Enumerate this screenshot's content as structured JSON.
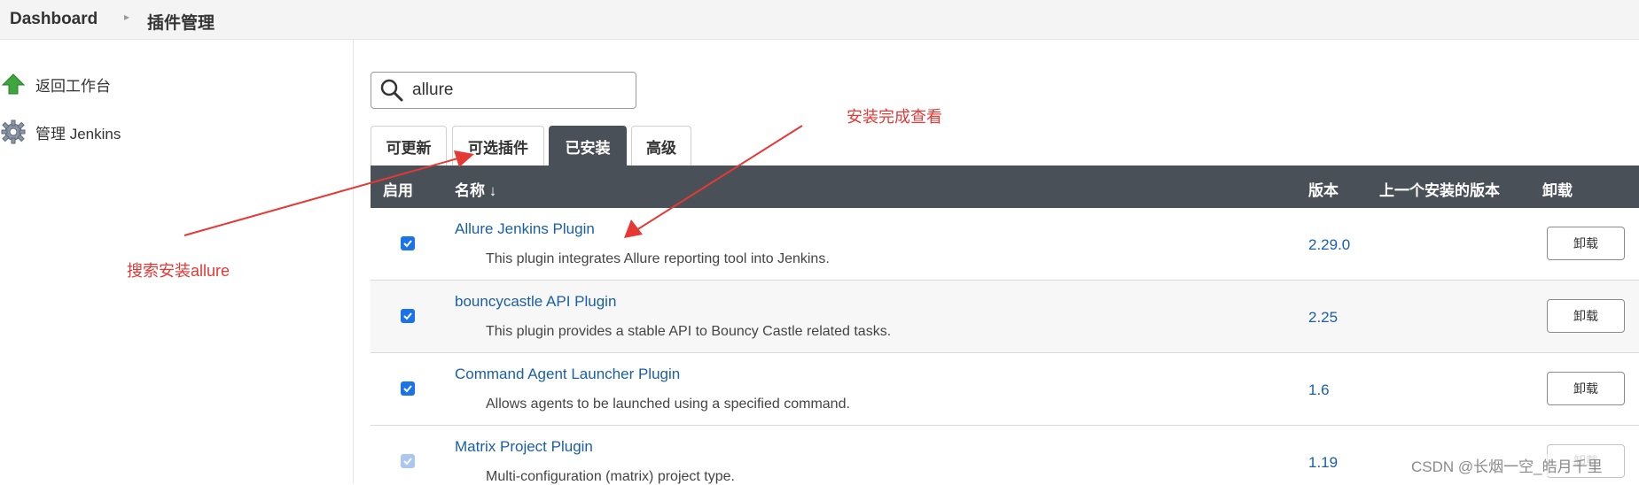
{
  "breadcrumb": {
    "home": "Dashboard",
    "current": "插件管理"
  },
  "sidebar": {
    "items": [
      {
        "label": "返回工作台",
        "icon": "up-arrow-icon"
      },
      {
        "label": "管理 Jenkins",
        "icon": "gear-icon"
      }
    ]
  },
  "search": {
    "value": "allure",
    "icon": "search-icon"
  },
  "tabs": [
    {
      "label": "可更新",
      "active": false
    },
    {
      "label": "可选插件",
      "active": false
    },
    {
      "label": "已安装",
      "active": true
    },
    {
      "label": "高级",
      "active": false
    }
  ],
  "table": {
    "headers": {
      "enabled": "启用",
      "name": "名称 ↓",
      "version": "版本",
      "previous": "上一个安装的版本",
      "uninstall": "卸载"
    },
    "rows": [
      {
        "enabled": true,
        "name": "Allure Jenkins Plugin",
        "description": "This plugin integrates Allure reporting tool into Jenkins.",
        "version": "2.29.0",
        "uninstall": "卸载"
      },
      {
        "enabled": true,
        "name": "bouncycastle API Plugin",
        "description": "This plugin provides a stable API to Bouncy Castle related tasks.",
        "version": "2.25",
        "uninstall": "卸载"
      },
      {
        "enabled": true,
        "name": "Command Agent Launcher Plugin",
        "description": "Allows agents to be launched using a specified command.",
        "version": "1.6",
        "uninstall": "卸载"
      },
      {
        "enabled": true,
        "name": "Matrix Project Plugin",
        "description": "Multi-configuration (matrix) project type.",
        "version": "1.19",
        "uninstall": "卸载"
      }
    ]
  },
  "annotations": {
    "search_note": "搜索安装allure",
    "installed_note": "安装完成查看"
  },
  "watermark": "CSDN @长烟一空_皓月千里",
  "colors": {
    "header_bg": "#4a5058",
    "link": "#1a5fa5",
    "annotation": "#e53935",
    "checkbox": "#1a73e8"
  }
}
